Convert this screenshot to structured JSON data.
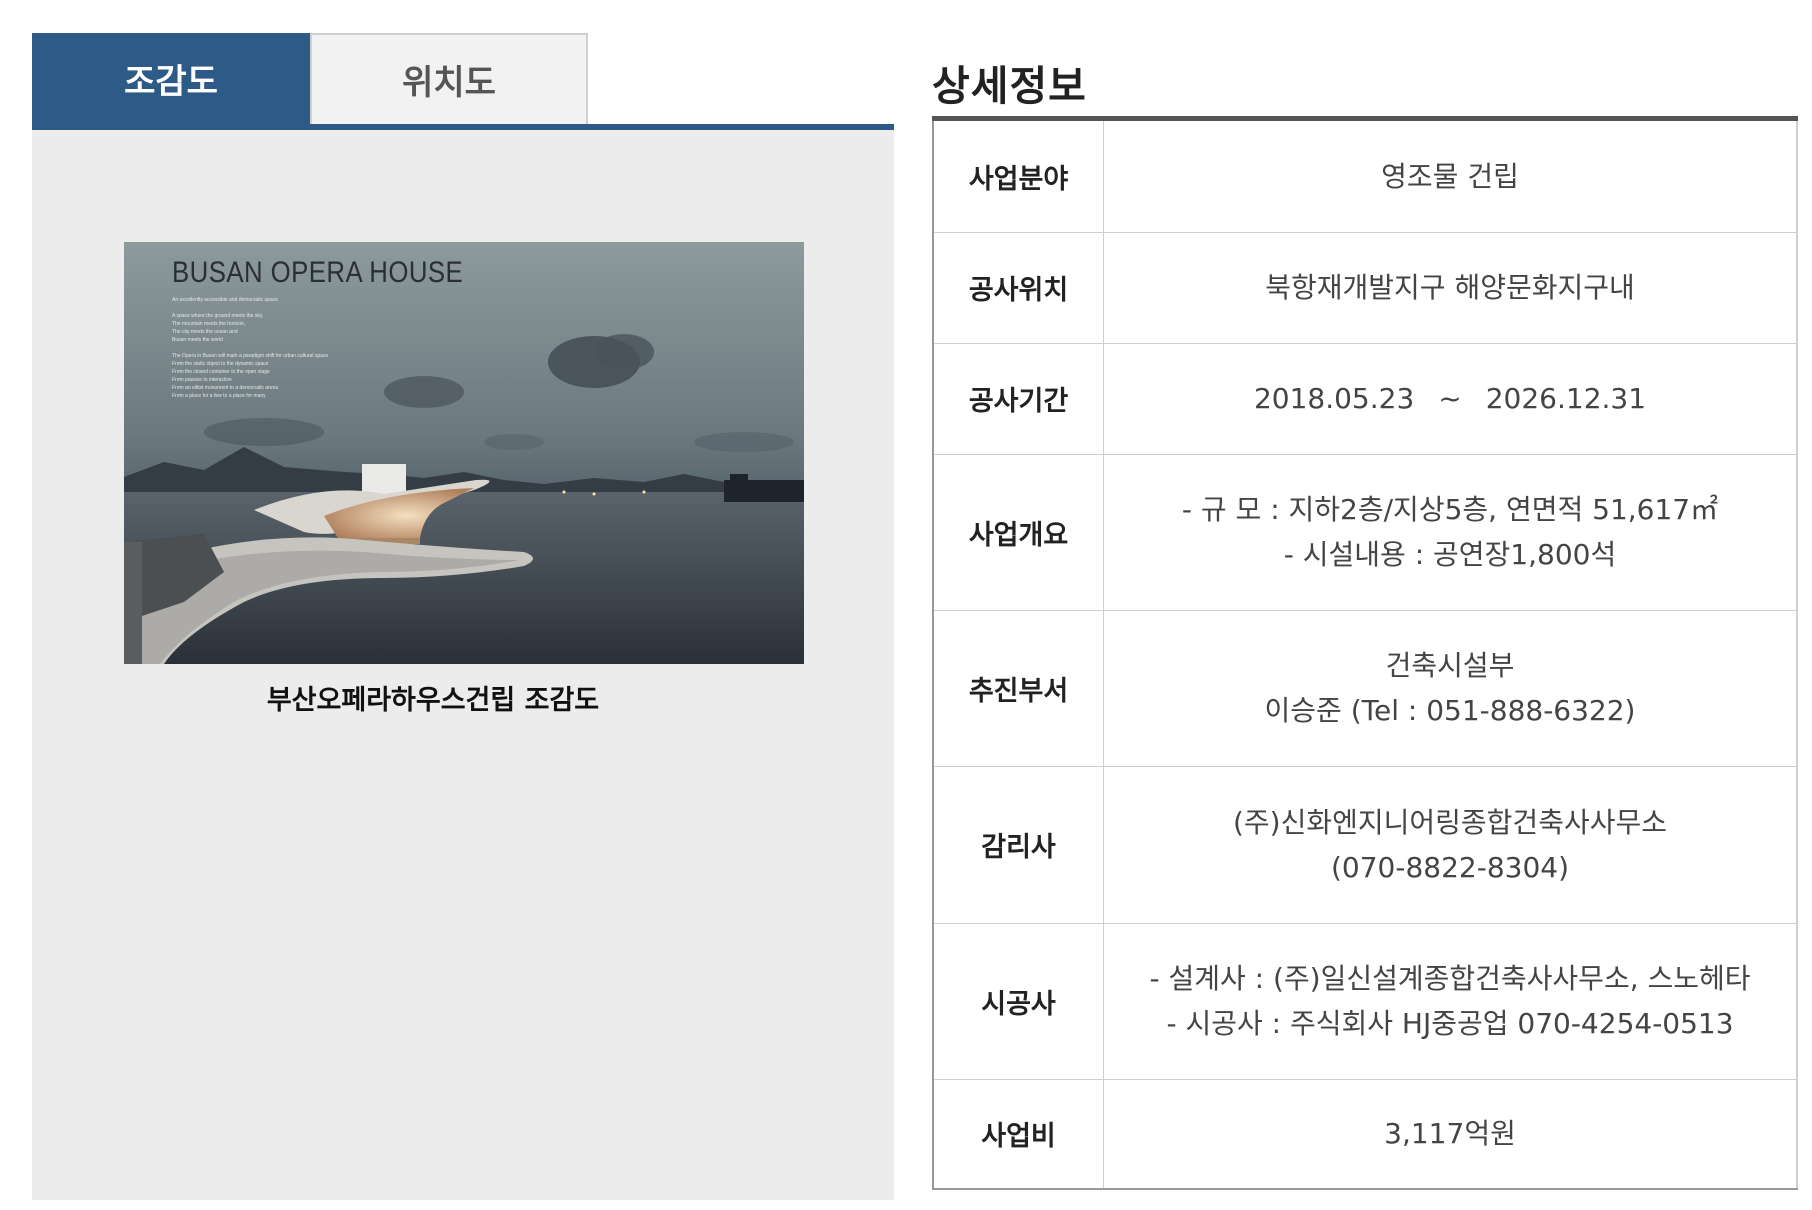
{
  "tabs": [
    {
      "label": "조감도",
      "active": true
    },
    {
      "label": "위치도",
      "active": false
    }
  ],
  "image": {
    "overlay_title": "BUSAN OPERA HOUSE",
    "overlay_lines": [
      "An excellently accessible and democratic space",
      "",
      "A space where the ground meets the sky,",
      "The mountain meets the horizon,",
      "The city meets the ocean and",
      "Busan meets the world",
      "",
      "The Opera in Busan will mark a paradigm shift for urban cultural space",
      "From the static object to the dynamic space",
      "From the closed container to the open stage",
      "From passive to interactive",
      "From an elitist monument to a democratic arena",
      "From a place for a few to a place for many"
    ],
    "caption": "부산오페라하우스건립 조감도"
  },
  "detail": {
    "title": "상세정보",
    "rows": [
      {
        "label": "사업분야",
        "lines": [
          "영조물 건립"
        ]
      },
      {
        "label": "공사위치",
        "lines": [
          "북항재개발지구 해양문화지구내"
        ]
      },
      {
        "label": "공사기간",
        "start": "2018.05.23",
        "sep": "~",
        "end": "2026.12.31"
      },
      {
        "label": "사업개요",
        "lines": [
          "- 규 모 : 지하2층/지상5층, 연면적 51,617㎡",
          "- 시설내용 : 공연장1,800석"
        ]
      },
      {
        "label": "추진부서",
        "lines": [
          "건축시설부",
          "이승준 (Tel : 051-888-6322)"
        ]
      },
      {
        "label": "감리사",
        "lines": [
          "(주)신화엔지니어링종합건축사사무소",
          "(070-8822-8304)"
        ]
      },
      {
        "label": "시공사",
        "lines": [
          "- 설계사 : (주)일신설계종합건축사사무소, 스노헤타",
          "- 시공사 : 주식회사 HJ중공업 070-4254-0513"
        ]
      },
      {
        "label": "사업비",
        "lines": [
          "3,117억원"
        ]
      }
    ]
  }
}
